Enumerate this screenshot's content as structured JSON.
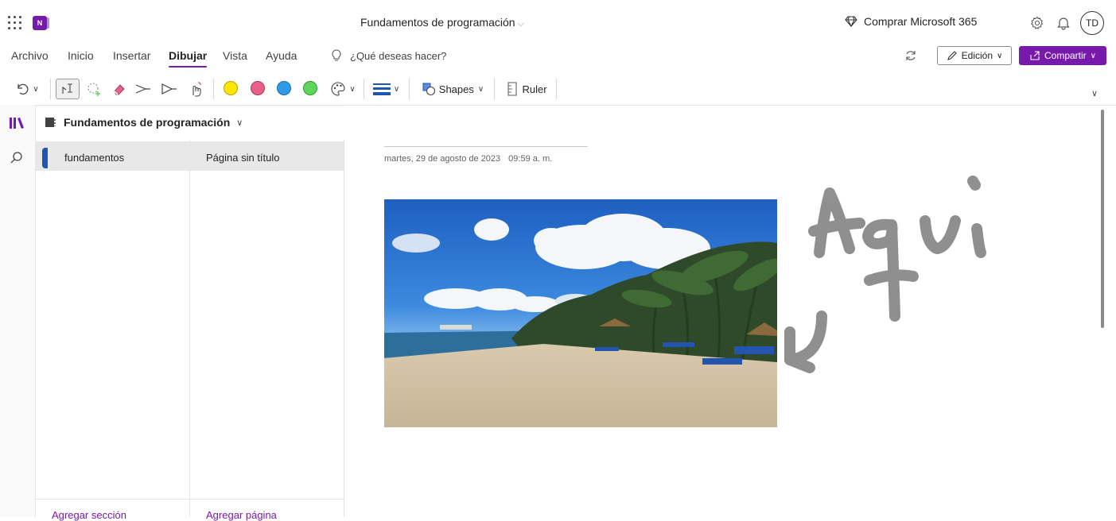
{
  "app": {
    "logo_letter": "N",
    "notebook_title": "Fundamentos de programación",
    "buy_label": "Comprar Microsoft 365",
    "user_initials": "TD",
    "accent_color": "#7719aa"
  },
  "menu": {
    "tabs": [
      "Archivo",
      "Inicio",
      "Insertar",
      "Dibujar",
      "Vista",
      "Ayuda"
    ],
    "active_tab": "Dibujar",
    "search_hint": "¿Qué deseas hacer?",
    "edit_label": "Edición",
    "share_label": "Compartir"
  },
  "ribbon": {
    "pen_colors": [
      "#ffe600",
      "#e8608a",
      "#2f9be6",
      "#5ed65b"
    ],
    "shapes_label": "Shapes",
    "ruler_label": "Ruler",
    "icons": [
      "undo-icon",
      "lasso-select-icon",
      "lasso-add-icon",
      "eraser-icon",
      "pen-icon",
      "highlighter-icon",
      "touch-draw-icon",
      "color-palette-icon",
      "line-weight-icon",
      "shapes-icon",
      "ruler-icon"
    ]
  },
  "nav": {
    "notebook_name": "Fundamentos de programación",
    "section": "fundamentos",
    "section_color": "#1f56b3",
    "page": "Página sin título",
    "add_section": "Agregar sección",
    "add_page": "Agregar página"
  },
  "page": {
    "date": "martes, 29 de agosto de 2023",
    "time": "09:59 a. m.",
    "ink_color": "#8a8a8a"
  }
}
